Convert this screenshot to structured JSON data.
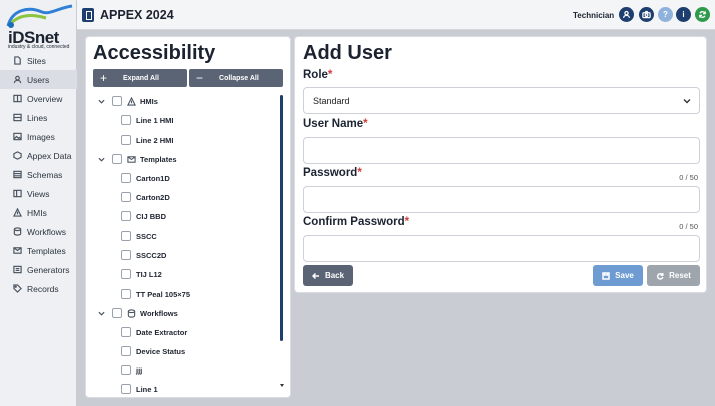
{
  "app": {
    "title": "APPEX 2024",
    "logo_text": "iDSnet",
    "logo_tag": "industry & cloud, connected"
  },
  "user": {
    "role_label": "Technician"
  },
  "colors": {
    "navy": "#1d3e6e",
    "accent_blue": "#6e9bd1",
    "gray_button": "#9ea5ad",
    "dark_button": "#5a6475",
    "required": "#d23b3b",
    "green": "#2f9a4c"
  },
  "topbar_icons": [
    "user-icon",
    "camera-icon",
    "help-icon",
    "info-icon",
    "refresh-icon"
  ],
  "sidebar": {
    "items": [
      {
        "label": "Sites",
        "icon": "file-icon"
      },
      {
        "label": "Users",
        "icon": "user-icon",
        "active": true
      },
      {
        "label": "Overview",
        "icon": "overview-icon"
      },
      {
        "label": "Lines",
        "icon": "lines-icon"
      },
      {
        "label": "Images",
        "icon": "image-icon"
      },
      {
        "label": "Appex Data",
        "icon": "data-icon"
      },
      {
        "label": "Schemas",
        "icon": "schema-icon"
      },
      {
        "label": "Views",
        "icon": "views-icon"
      },
      {
        "label": "HMIs",
        "icon": "hmi-icon"
      },
      {
        "label": "Workflows",
        "icon": "workflow-icon"
      },
      {
        "label": "Templates",
        "icon": "template-icon"
      },
      {
        "label": "Generators",
        "icon": "generator-icon"
      },
      {
        "label": "Records",
        "icon": "tag-icon"
      }
    ]
  },
  "accessibility": {
    "title": "Accessibility",
    "expand_all": "Expand All",
    "collapse_all": "Collapse All",
    "groups": [
      {
        "label": "HMIs",
        "icon": "hmi-icon",
        "children": [
          "Line 1 HMI",
          "Line 2 HMI"
        ]
      },
      {
        "label": "Templates",
        "icon": "template-icon",
        "children": [
          "Carton1D",
          "Carton2D",
          "CIJ BBD",
          "SSCC",
          "SSCC2D",
          "TIJ L12",
          "TT Peal 105×75"
        ]
      },
      {
        "label": "Workflows",
        "icon": "workflow-icon",
        "children": [
          "Date Extractor",
          "Device Status",
          "jjj",
          "Line 1"
        ]
      }
    ]
  },
  "form": {
    "title": "Add User",
    "role_label": "Role",
    "role_value": "Standard",
    "username_label": "User Name",
    "password_label": "Password",
    "password_counter": "0 / 50",
    "confirm_label": "Confirm Password",
    "confirm_counter": "0 / 50",
    "back": "Back",
    "save": "Save",
    "reset": "Reset"
  }
}
